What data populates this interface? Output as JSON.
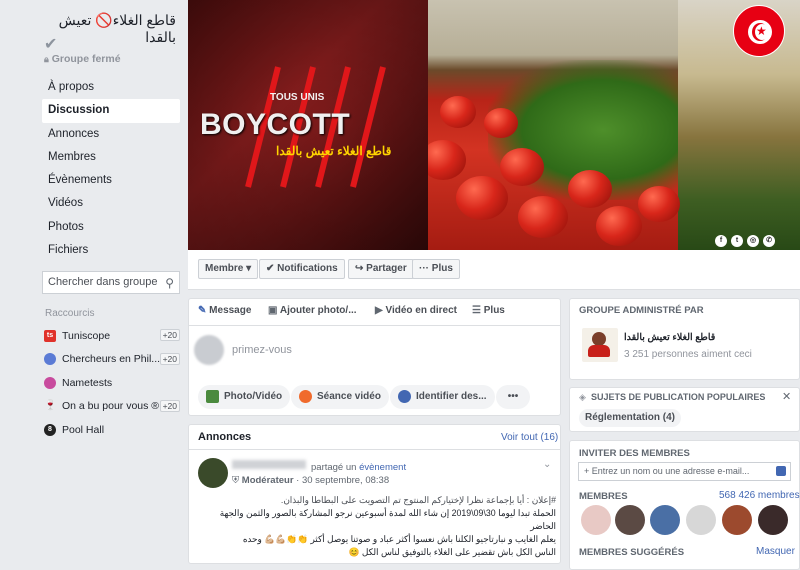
{
  "group": {
    "name": "قاطع الغلاء🚫 تعيش بالقدا",
    "verified_icon": "check-icon",
    "privacy": "Groupe fermé"
  },
  "nav": [
    {
      "label": "À propos"
    },
    {
      "label": "Discussion",
      "active": true
    },
    {
      "label": "Annonces"
    },
    {
      "label": "Membres"
    },
    {
      "label": "Évènements"
    },
    {
      "label": "Vidéos"
    },
    {
      "label": "Photos"
    },
    {
      "label": "Fichiers"
    }
  ],
  "search": {
    "placeholder": "Chercher dans groupe"
  },
  "shortcuts": {
    "title": "Raccourcis",
    "items": [
      {
        "label": "Tuniscope",
        "count": "+20",
        "icon_text": "ts",
        "color": "#e0312a"
      },
      {
        "label": "Chercheurs en Phil...",
        "count": "+20",
        "icon_text": "",
        "color": "#5b7bd5"
      },
      {
        "label": "Nametests",
        "count": "",
        "icon_text": "",
        "color": "#c84b9e"
      },
      {
        "label": "On a bu pour vous ®",
        "count": "+20",
        "icon_text": "🍷",
        "color": "#ffffff"
      },
      {
        "label": "Pool Hall",
        "count": "",
        "icon_text": "8",
        "color": "#222222"
      }
    ]
  },
  "cover": {
    "headline": "BOYCOTT",
    "tagline": "TOUS UNIS",
    "arabic_slogan": "قاطع الغلاء تعيش بالقدا"
  },
  "actions": {
    "member": "Membre ▾",
    "notifications": "✔ Notifications",
    "share": "↪ Partager",
    "more": "··· Plus"
  },
  "composer": {
    "tabs": [
      "Message",
      "Ajouter photo/...",
      "Vidéo en direct",
      "Plus"
    ],
    "placeholder": "primez-vous",
    "chips": [
      "Photo/Vidéo",
      "Séance vidéo",
      "Identifier des..."
    ],
    "more": "•••"
  },
  "announcements": {
    "title": "Annonces",
    "see_all": "Voir tout (16)",
    "post": {
      "action_text": "partagé un",
      "action_link": "évènement",
      "role": "Modérateur",
      "date": "· 30 septembre, 08:38",
      "lines": [
        "#إعلان : أيا بإجماعة نظرا لإختياركم المنتوج تم التصويت على البطاطا والبذان.",
        "الحملة تبدا ليوما 30\\09\\2019 إن شاء الله لمدة أسبوعين نرجو المشاركة بالصور والثمن والجهة الحاضر",
        "يعلم الغايب و نبارتاجيو الكلنا باش نعسوا أكثر عباد و صوتنا يوصل أكثر 👏👏💪🏼💪🏼 وحده",
        "الناس الكل باش تقضير على الغلاء بالتوفيق لناس الكل 😊"
      ]
    }
  },
  "admin": {
    "heading": "GROUPE ADMINISTRÉ PAR",
    "page_name": "قاطع الغلاء تعيش بالقدا",
    "likes": "3 251 personnes aiment ceci"
  },
  "topics": {
    "heading": "SUJETS DE PUBLICATION POPULAIRES",
    "items": [
      "Réglementation (4)"
    ]
  },
  "invite": {
    "heading": "INVITER DES MEMBRES",
    "placeholder": "+  Entrez un nom ou une adresse e-mail..."
  },
  "members": {
    "heading": "MEMBRES",
    "count": "568 426 membres",
    "avatar_colors": [
      "#e8c9c5",
      "#5b4a44",
      "#4a6fa5",
      "#d7d7d7",
      "#9c4a2e",
      "#3a2a2a"
    ]
  },
  "suggested": {
    "heading": "MEMBRES SUGGÉRÉS",
    "hide": "Masquer"
  }
}
